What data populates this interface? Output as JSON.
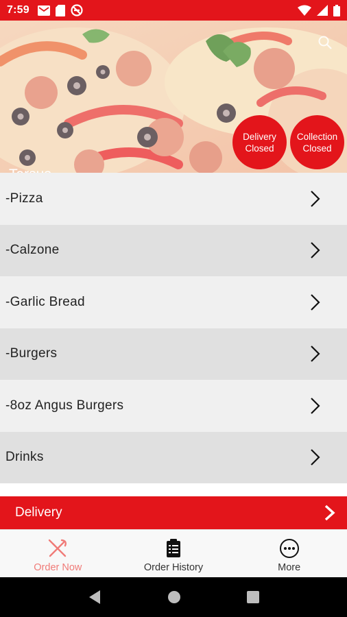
{
  "status_bar": {
    "time": "7:59",
    "left_icons": [
      "mail-icon",
      "sd-card-icon",
      "do-not-disturb-icon"
    ],
    "right_icons": [
      "wifi-icon",
      "signal-icon",
      "battery-icon"
    ]
  },
  "hero": {
    "restaurant_name": "Tarsus",
    "search_icon": "search-icon",
    "delivery_badge": "Delivery Closed",
    "collection_badge": "Collection Closed"
  },
  "categories": [
    {
      "label": "-Pizza"
    },
    {
      "label": "-Calzone"
    },
    {
      "label": "-Garlic Bread"
    },
    {
      "label": "-Burgers"
    },
    {
      "label": "-8oz Angus Burgers"
    },
    {
      "label": "Drinks"
    }
  ],
  "delivery_bar": {
    "label": "Delivery"
  },
  "bottom_nav": {
    "items": [
      {
        "label": "Order Now",
        "icon": "fork-knife-icon",
        "active": true
      },
      {
        "label": "Order History",
        "icon": "clipboard-icon",
        "active": false
      },
      {
        "label": "More",
        "icon": "more-icon",
        "active": false
      }
    ]
  },
  "colors": {
    "brand_red": "#e3151b",
    "active_nav": "#f07b78",
    "row_light": "#f0f0f0",
    "row_dark": "#e0e0e0"
  }
}
